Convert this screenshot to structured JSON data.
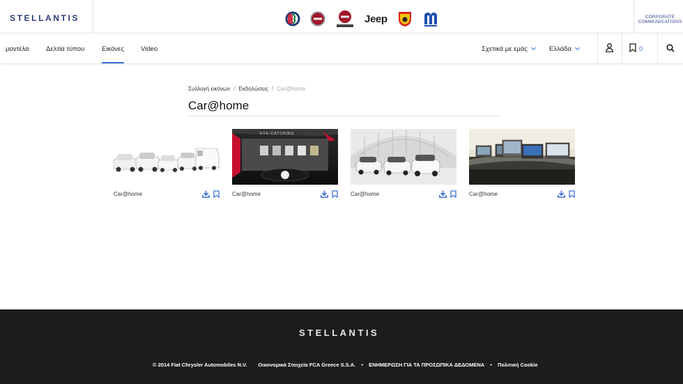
{
  "header": {
    "logo_text": "STELLANTIS",
    "corporate": [
      "CORPORATE",
      "COMMUNICATIONS"
    ],
    "brands": [
      "alfa-romeo-logo",
      "fiat-logo",
      "fiat-professional-logo",
      "jeep-logo",
      "abarth-logo",
      "mopar-logo"
    ],
    "jeep_text": "Jeep"
  },
  "nav": {
    "items": [
      "μοντέλα",
      "Δελτία τύπου",
      "Εικόνες",
      "Video"
    ],
    "active": "Εικόνες",
    "about": "Σχετικά με εμάς",
    "country": "Ελλάδα",
    "bookmark_count": "0"
  },
  "breadcrumb": {
    "items": [
      "Συλλογή εικόνων",
      "Εκδηλώσεις",
      "Car@home"
    ],
    "separator": "/"
  },
  "page": {
    "title": "Car@home"
  },
  "cards": [
    {
      "label": "Car@home",
      "thumb": "white cars lineup"
    },
    {
      "label": "Car@home",
      "thumb": "EYE-CATCHING exhibition wall"
    },
    {
      "label": "Car@home",
      "thumb": "three white cars in dome hall"
    },
    {
      "label": "Car@home",
      "thumb": "laptops on car roof"
    }
  ],
  "footer": {
    "logo_text": "STELLANTIS",
    "links": [
      "© 2014 Fiat Chrysler Automobiles N.V.",
      "Οικονομικά Στοιχεία FCA Greece S.S.A.",
      "ΕΝΗΜΕΡΩΣΗ ΓΙΑ ΤΑ ΠΡΟΣΩΠΙΚΑ ΔΕΔΟΜΕΝΑ",
      "Πολιτική Cookie"
    ]
  },
  "colors": {
    "accent": "#3b6fd6",
    "brand_navy": "#2a3d73",
    "footer_bg": "#1d1d1d"
  }
}
